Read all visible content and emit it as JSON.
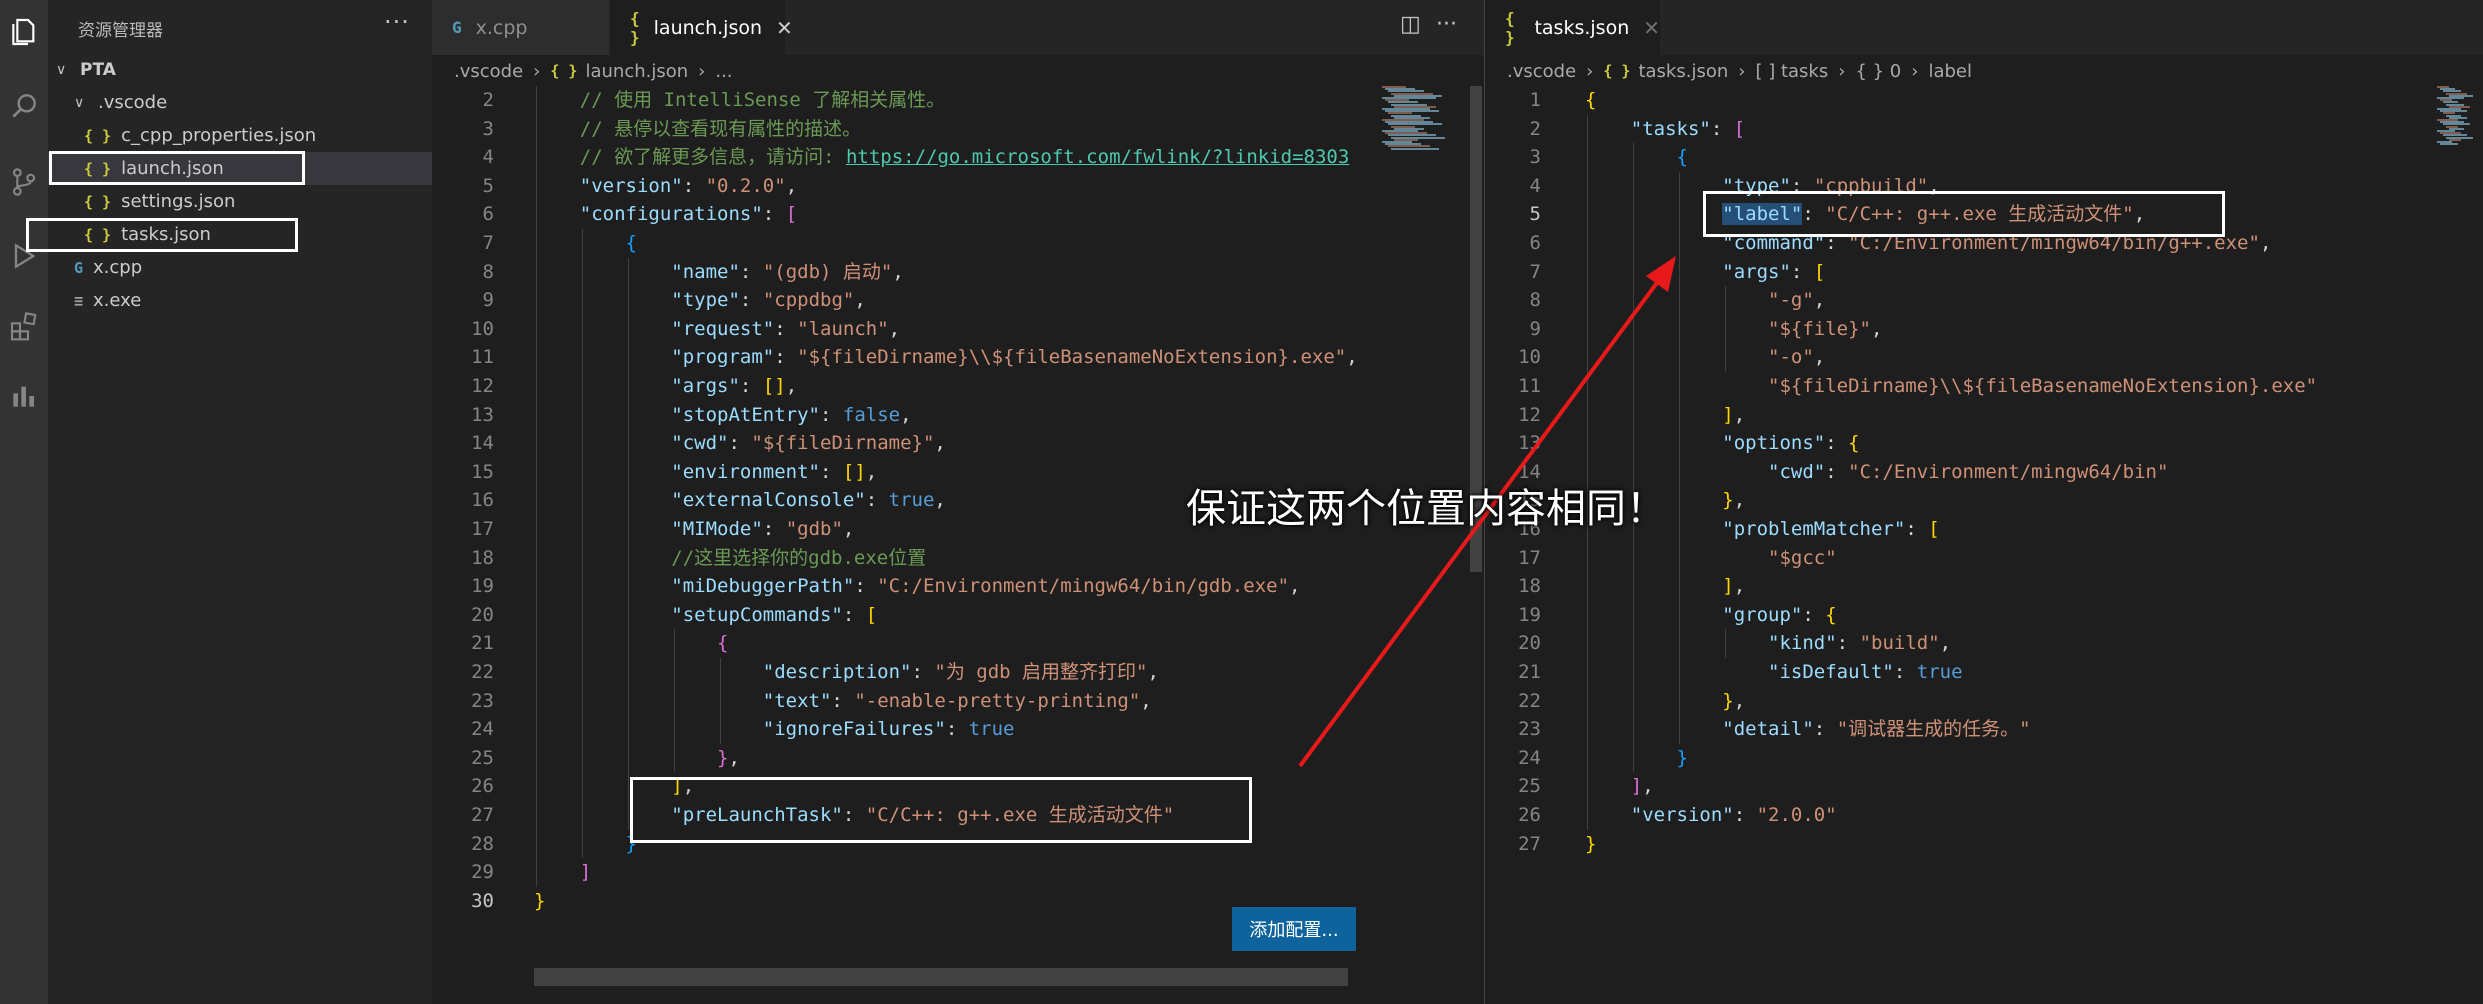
{
  "sidebar": {
    "title": "资源管理器",
    "more": "···",
    "folder": "PTA",
    "items": [
      {
        "label": ".vscode",
        "type": "folder"
      },
      {
        "label": "c_cpp_properties.json",
        "type": "json"
      },
      {
        "label": "launch.json",
        "type": "json",
        "active": true
      },
      {
        "label": "settings.json",
        "type": "json"
      },
      {
        "label": "tasks.json",
        "type": "json"
      },
      {
        "label": "x.cpp",
        "type": "cpp"
      },
      {
        "label": "x.exe",
        "type": "exe"
      }
    ]
  },
  "icons": {
    "json": "{ }",
    "cpp": "G",
    "exe": "≡",
    "chevron_down": "∨",
    "close": "✕"
  },
  "group1": {
    "tabs": [
      {
        "label": "x.cpp",
        "icon": "cpp-icon"
      },
      {
        "label": "launch.json",
        "icon": "json-icon",
        "active": true
      }
    ],
    "breadcrumb": [
      ".vscode",
      "launch.json",
      "..."
    ],
    "add_config_label": "添加配置...",
    "current_line": 30,
    "lines": [
      {
        "n": 2,
        "html": "    <span class='c'>// 使用 IntelliSense 了解相关属性。</span>"
      },
      {
        "n": 3,
        "html": "    <span class='c'>// 悬停以查看现有属性的描述。</span>"
      },
      {
        "n": 4,
        "html": "    <span class='c'>// 欲了解更多信息，请访问: </span><span class='u'>https://go.microsoft.com/fwlink/?linkid=8303</span>"
      },
      {
        "n": 5,
        "html": "    <span class='k'>\"version\"</span>: <span class='s'>\"0.2.0\"</span>,"
      },
      {
        "n": 6,
        "html": "    <span class='k'>\"configurations\"</span>: <span class='p2'>[</span>"
      },
      {
        "n": 7,
        "html": "        <span class='p3'>{</span>"
      },
      {
        "n": 8,
        "html": "            <span class='k'>\"name\"</span>: <span class='s'>\"(gdb) 启动\"</span>,"
      },
      {
        "n": 9,
        "html": "            <span class='k'>\"type\"</span>: <span class='s'>\"cppdbg\"</span>,"
      },
      {
        "n": 10,
        "html": "            <span class='k'>\"request\"</span>: <span class='s'>\"launch\"</span>,"
      },
      {
        "n": 11,
        "html": "            <span class='k'>\"program\"</span>: <span class='s'>\"${fileDirname}\\\\${fileBasenameNoExtension}.exe\"</span>,"
      },
      {
        "n": 12,
        "html": "            <span class='k'>\"args\"</span>: <span class='p1'>[]</span>,"
      },
      {
        "n": 13,
        "html": "            <span class='k'>\"stopAtEntry\"</span>: <span class='b'>false</span>,"
      },
      {
        "n": 14,
        "html": "            <span class='k'>\"cwd\"</span>: <span class='s'>\"${fileDirname}\"</span>,"
      },
      {
        "n": 15,
        "html": "            <span class='k'>\"environment\"</span>: <span class='p1'>[]</span>,"
      },
      {
        "n": 16,
        "html": "            <span class='k'>\"externalConsole\"</span>: <span class='b'>true</span>,"
      },
      {
        "n": 17,
        "html": "            <span class='k'>\"MIMode\"</span>: <span class='s'>\"gdb\"</span>,"
      },
      {
        "n": 18,
        "html": "            <span class='c'>//这里选择你的gdb.exe位置</span>"
      },
      {
        "n": 19,
        "html": "            <span class='k'>\"miDebuggerPath\"</span>: <span class='s'>\"C:/Environment/mingw64/bin/gdb.exe\"</span>,"
      },
      {
        "n": 20,
        "html": "            <span class='k'>\"setupCommands\"</span>: <span class='p1'>[</span>"
      },
      {
        "n": 21,
        "html": "                <span class='p2'>{</span>"
      },
      {
        "n": 22,
        "html": "                    <span class='k'>\"description\"</span>: <span class='s'>\"为 gdb 启用整齐打印\"</span>,"
      },
      {
        "n": 23,
        "html": "                    <span class='k'>\"text\"</span>: <span class='s'>\"-enable-pretty-printing\"</span>,"
      },
      {
        "n": 24,
        "html": "                    <span class='k'>\"ignoreFailures\"</span>: <span class='b'>true</span>"
      },
      {
        "n": 25,
        "html": "                <span class='p2'>}</span>,"
      },
      {
        "n": 26,
        "html": "            <span class='p1'>]</span>,"
      },
      {
        "n": 27,
        "html": "            <span class='k'>\"preLaunchTask\"</span>: <span class='s'>\"C/C++: g++.exe 生成活动文件\"</span>"
      },
      {
        "n": 28,
        "html": "        <span class='p3'>}</span>"
      },
      {
        "n": 29,
        "html": "    <span class='p2'>]</span>"
      },
      {
        "n": 30,
        "html": "<span class='p1'>}</span>"
      }
    ]
  },
  "group2": {
    "tabs": [
      {
        "label": "tasks.json",
        "icon": "json-icon",
        "active": true
      }
    ],
    "breadcrumb": [
      ".vscode",
      "tasks.json",
      "[ ] tasks",
      "{ } 0",
      "label"
    ],
    "current_line": 5,
    "lines": [
      {
        "n": 1,
        "html": "<span class='p1'>{</span>"
      },
      {
        "n": 2,
        "html": "    <span class='k'>\"tasks\"</span>: <span class='p2'>[</span>"
      },
      {
        "n": 3,
        "html": "        <span class='p3'>{</span>"
      },
      {
        "n": 4,
        "html": "            <span class='k'>\"type\"</span>: <span class='s'>\"cppbuild\"</span>,"
      },
      {
        "n": 5,
        "html": "            <span class='k sel'>\"label\"</span>: <span class='s'>\"C/C++: g++.exe 生成活动文件\"</span>,"
      },
      {
        "n": 6,
        "html": "            <span class='k'>\"command\"</span>: <span class='s'>\"C:/Environment/mingw64/bin/g++.exe\"</span>,"
      },
      {
        "n": 7,
        "html": "            <span class='k'>\"args\"</span>: <span class='p1'>[</span>"
      },
      {
        "n": 8,
        "html": "                <span class='s'>\"-g\"</span>,"
      },
      {
        "n": 9,
        "html": "                <span class='s'>\"${file}\"</span>,"
      },
      {
        "n": 10,
        "html": "                <span class='s'>\"-o\"</span>,"
      },
      {
        "n": 11,
        "html": "                <span class='s'>\"${fileDirname}\\\\${fileBasenameNoExtension}.exe\"</span>"
      },
      {
        "n": 12,
        "html": "            <span class='p1'>]</span>,"
      },
      {
        "n": 13,
        "html": "            <span class='k'>\"options\"</span>: <span class='p1'>{</span>"
      },
      {
        "n": 14,
        "html": "                <span class='k'>\"cwd\"</span>: <span class='s'>\"C:/Environment/mingw64/bin\"</span>"
      },
      {
        "n": 15,
        "html": "            <span class='p1'>}</span>,"
      },
      {
        "n": 16,
        "html": "            <span class='k'>\"problemMatcher\"</span>: <span class='p1'>[</span>"
      },
      {
        "n": 17,
        "html": "                <span class='s'>\"$gcc\"</span>"
      },
      {
        "n": 18,
        "html": "            <span class='p1'>]</span>,"
      },
      {
        "n": 19,
        "html": "            <span class='k'>\"group\"</span>: <span class='p1'>{</span>"
      },
      {
        "n": 20,
        "html": "                <span class='k'>\"kind\"</span>: <span class='s'>\"build\"</span>,"
      },
      {
        "n": 21,
        "html": "                <span class='k'>\"isDefault\"</span>: <span class='b'>true</span>"
      },
      {
        "n": 22,
        "html": "            <span class='p1'>}</span>,"
      },
      {
        "n": 23,
        "html": "            <span class='k'>\"detail\"</span>: <span class='s'>\"调试器生成的任务。\"</span>"
      },
      {
        "n": 24,
        "html": "        <span class='p3'>}</span>"
      },
      {
        "n": 25,
        "html": "    <span class='p2'>]</span>,"
      },
      {
        "n": 26,
        "html": "    <span class='k'>\"version\"</span>: <span class='s'>\"2.0.0\"</span>"
      },
      {
        "n": 27,
        "html": "<span class='p1'>}</span>"
      }
    ]
  },
  "annotation": {
    "text": "保证这两个位置内容相同！",
    "arrow_color": "#e8191a",
    "box_color": "#ffffff"
  },
  "colors": {
    "key": "#9cdcfe",
    "string": "#ce9178",
    "boolean": "#569cd6",
    "comment": "#6a9955",
    "button": "#0e639c"
  }
}
